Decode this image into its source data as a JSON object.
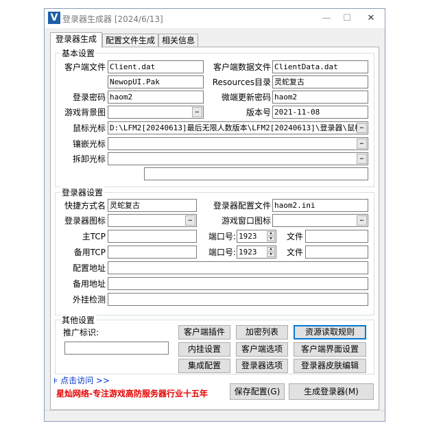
{
  "window": {
    "title": "登录器生成器 [2024/6/13]",
    "minimize": "—",
    "maximize": "☐",
    "close": "✕"
  },
  "tabs": [
    {
      "label": "登录器生成",
      "active": true
    },
    {
      "label": "配置文件生成",
      "active": false
    },
    {
      "label": "相关信息",
      "active": false
    }
  ],
  "basic": {
    "title": "基本设置",
    "client_file_label": "客户端文件",
    "client_file_value": "Client.dat",
    "client_data_label": "客户端数据文件",
    "client_data_value": "ClientData.dat",
    "ui_pak_value": "NewopUI.Pak",
    "resources_label": "Resources目录",
    "resources_value": "灵蛇复古",
    "login_pwd_label": "登录密码",
    "login_pwd_value": "haom2",
    "micro_update_pwd_label": "微端更新密码",
    "micro_update_pwd_value": "haom2",
    "game_bg_label": "游戏背景图",
    "game_bg_value": "",
    "version_label": "版本号",
    "version_value": "2021-11-08",
    "cursor_label": "鼠标光标",
    "cursor_value": "D:\\LFM2[20240613]最后无限人数版本\\LFM2[20240613]\\登录器\\鼠标",
    "inlay_cursor_label": "镶嵌光标",
    "inlay_cursor_value": "",
    "remove_cursor_label": "拆卸光标",
    "remove_cursor_value": "",
    "extra_value": ""
  },
  "launcher": {
    "title": "登录器设置",
    "shortcut_label": "快捷方式名",
    "shortcut_value": "灵蛇复古",
    "config_file_label": "登录器配置文件",
    "config_file_value": "haom2.ini",
    "icon_label": "登录器图标",
    "icon_value": "",
    "game_window_icon_label": "游戏窗口图标",
    "game_window_icon_value": "",
    "main_tcp_label": "主TCP",
    "main_tcp_value": "",
    "port_label_1": "端口号:",
    "port_value_1": "1923",
    "file_label_1": "文件",
    "file_value_1": "",
    "backup_tcp_label": "备用TCP",
    "backup_tcp_value": "",
    "port_label_2": "端口号:",
    "port_value_2": "1923",
    "file_label_2": "文件",
    "file_value_2": "",
    "config_addr_label": "配置地址",
    "config_addr_value": "",
    "backup_addr_label": "备用地址",
    "backup_addr_value": "",
    "plugin_detect_label": "外挂检测",
    "plugin_detect_value": ""
  },
  "other": {
    "title": "其他设置",
    "promo_id_label": "推广标识:",
    "promo_id_value": "",
    "buttons": {
      "client_plugin": "客户端插件",
      "encrypt_list": "加密列表",
      "resource_rules": "资源读取规则",
      "inner_plugin": "内挂设置",
      "client_options": "客户端选项",
      "client_ui": "客户端界面设置",
      "integrated_config": "集成配置",
      "launcher_options": "登录器选项",
      "skin_editor": "登录器皮肤编辑"
    }
  },
  "footer": {
    "link": "点击访问 >>",
    "promo": "星灿网络-专注游戏高防服务器行业十五年",
    "save": "保存配置(G)",
    "generate": "生成登录器(M)"
  },
  "icons": {
    "browse": "…",
    "spin_up": "▲",
    "spin_down": "▼",
    "link_glyph": "⊧"
  },
  "colors": {
    "accent": "#0078d7",
    "promo": "#e60000",
    "link": "#0033cc",
    "app_icon": "#1d5fa8"
  }
}
